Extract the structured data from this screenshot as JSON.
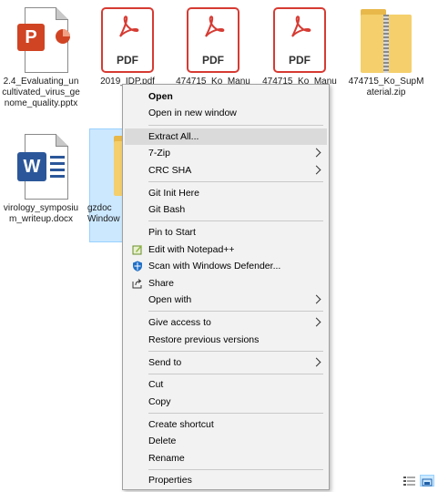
{
  "files": [
    {
      "label": "2.4_Evaluating_uncultivated_virus_genome_quality.pptx",
      "icon": "powerpoint-file-icon"
    },
    {
      "label": "2019_IDP.pdf",
      "icon": "pdf-file-icon"
    },
    {
      "label": "474715_Ko_Manu",
      "icon": "pdf-file-icon"
    },
    {
      "label": "474715_Ko_Manu",
      "icon": "pdf-file-icon"
    },
    {
      "label": "474715_Ko_SupMaterial.zip",
      "icon": "zip-folder-icon"
    },
    {
      "label": "virology_symposium_writeup.docx",
      "icon": "word-file-icon"
    },
    {
      "label": "gzdoc",
      "label2": "Window",
      "icon": "zip-folder-icon"
    }
  ],
  "pdf_badge": "PDF",
  "word_letter": "W",
  "ppt_letter": "P",
  "menu": {
    "open": "Open",
    "open_new_window": "Open in new window",
    "extract_all": "Extract All...",
    "sevenzip": "7-Zip",
    "crc_sha": "CRC SHA",
    "git_init": "Git Init Here",
    "git_bash": "Git Bash",
    "pin_start": "Pin to Start",
    "edit_notepad": "Edit with Notepad++",
    "scan_defender": "Scan with Windows Defender...",
    "share": "Share",
    "open_with": "Open with",
    "give_access": "Give access to",
    "restore_versions": "Restore previous versions",
    "send_to": "Send to",
    "cut": "Cut",
    "copy": "Copy",
    "create_shortcut": "Create shortcut",
    "delete": "Delete",
    "rename": "Rename",
    "properties": "Properties"
  },
  "colors": {
    "pdf_red": "#d63b33",
    "ppt_orange": "#d04423",
    "word_blue": "#2b579a",
    "folder_yellow": "#f4cf6c",
    "highlight": "#dadada",
    "selection": "#cce8ff"
  }
}
